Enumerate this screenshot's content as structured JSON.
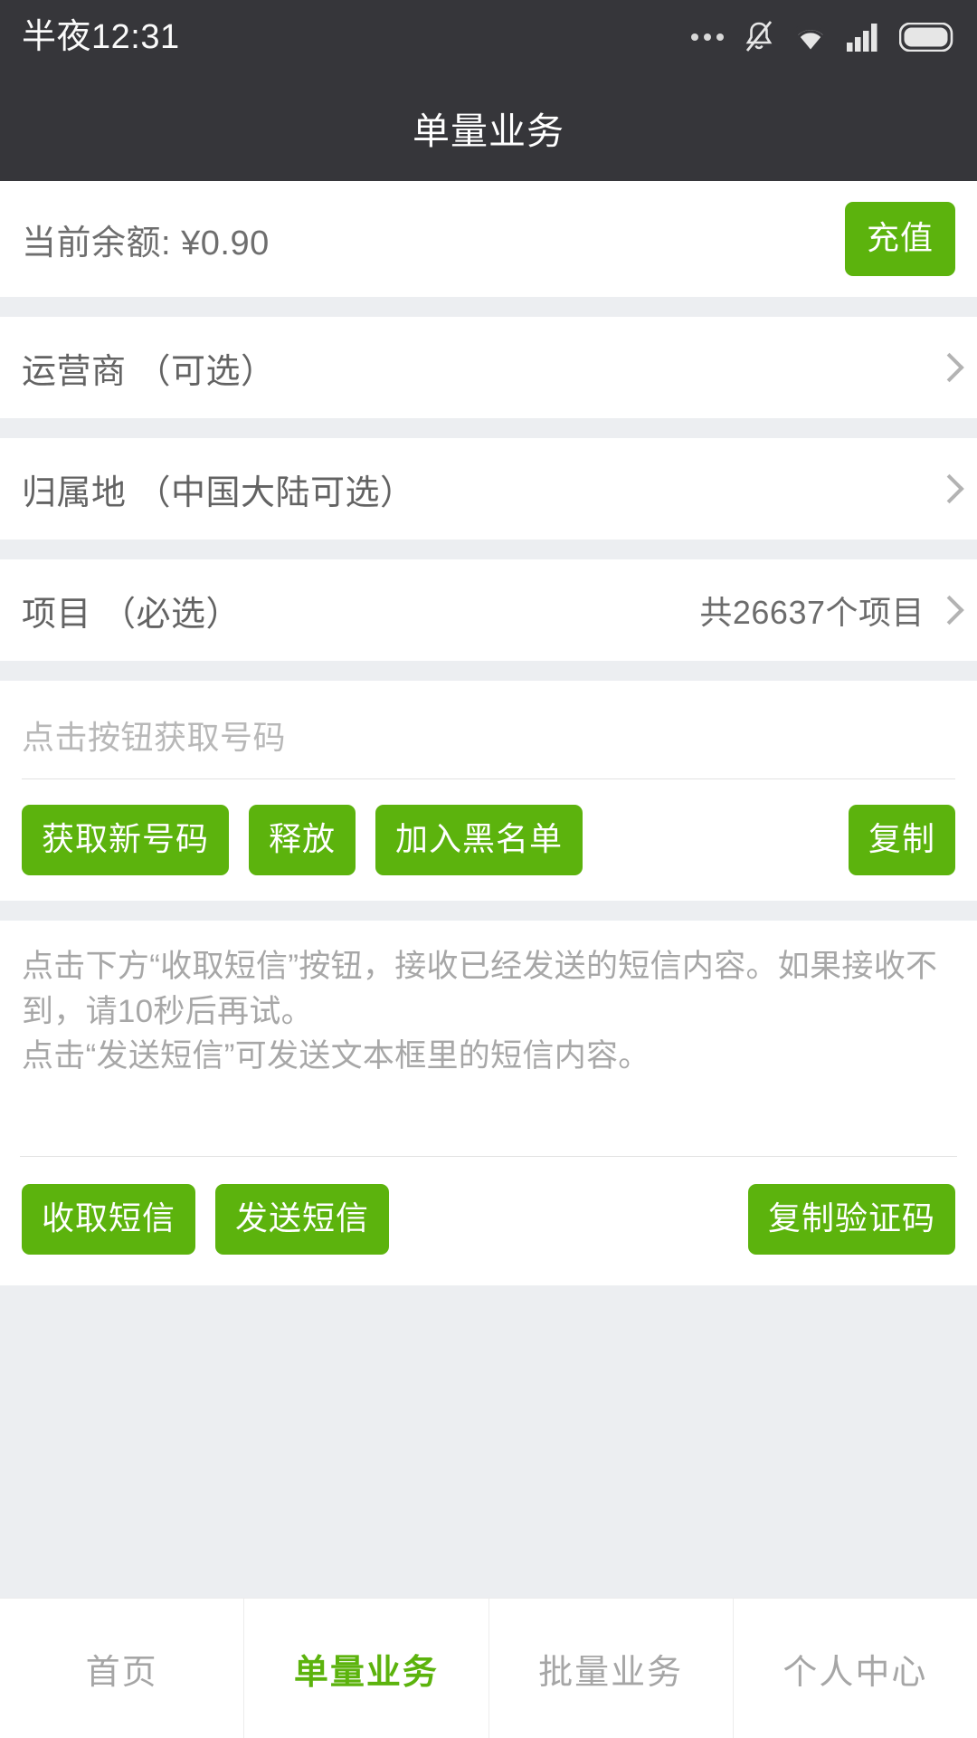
{
  "status_bar": {
    "time": "半夜12:31",
    "icons": [
      "more-dots-icon",
      "bell-muted-icon",
      "wifi-icon",
      "signal-icon",
      "battery-icon"
    ]
  },
  "nav": {
    "title": "单量业务"
  },
  "balance": {
    "label": "当前余额: ¥0.90",
    "recharge_label": "充值"
  },
  "rows": [
    {
      "label": "运营商 （可选）",
      "value": ""
    },
    {
      "label": "归属地 （中国大陆可选）",
      "value": ""
    },
    {
      "label": "项目 （必选）",
      "value": "共26637个项目"
    }
  ],
  "number_block": {
    "placeholder": "点击按钮获取号码",
    "value": "",
    "buttons": {
      "get_new": "获取新号码",
      "release": "释放",
      "blacklist": "加入黑名单",
      "copy": "复制"
    }
  },
  "sms_block": {
    "placeholder": "点击下方“收取短信”按钮，接收已经发送的短信内容。如果接收不到，请10秒后再试。\n点击“发送短信”可发送文本框里的短信内容。",
    "value": "",
    "buttons": {
      "receive": "收取短信",
      "send": "发送短信",
      "copy_code": "复制验证码"
    }
  },
  "tabbar": {
    "items": [
      {
        "label": "首页",
        "active": false
      },
      {
        "label": "单量业务",
        "active": true
      },
      {
        "label": "批量业务",
        "active": false
      },
      {
        "label": "个人中心",
        "active": false
      }
    ]
  },
  "colors": {
    "accent_green": "#5cb30d",
    "navbar_dark": "#36363a",
    "page_background": "#eceef1",
    "muted_text": "#a6a6a6"
  }
}
